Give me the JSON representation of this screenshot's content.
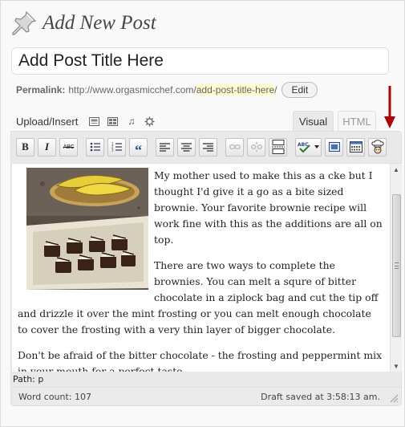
{
  "header": {
    "title": "Add New Post",
    "pin_icon": "pushpin-icon"
  },
  "title_input": {
    "value": "Add Post Title Here"
  },
  "permalink": {
    "label": "Permalink:",
    "base": "http://www.orgasmicchef.com/",
    "slug": "add-post-title-here",
    "trailing": "/",
    "edit_label": "Edit"
  },
  "upload": {
    "label": "Upload/Insert",
    "icons": [
      "add-image-icon",
      "add-video-icon",
      "add-audio-icon",
      "add-media-icon"
    ]
  },
  "tabs": {
    "visual": "Visual",
    "html": "HTML",
    "active": "Visual"
  },
  "toolbar": {
    "bold": "B",
    "italic": "I",
    "strikethrough": "ABC",
    "buttons": [
      "bold",
      "italic",
      "strikethrough",
      "bullet-list",
      "numbered-list",
      "blockquote",
      "align-left",
      "align-center",
      "align-right",
      "insert-link",
      "unlink",
      "insert-more",
      "spellcheck",
      "fullscreen",
      "kitchen-sink",
      "chef-plugin"
    ]
  },
  "content": {
    "paragraphs": [
      "My mother used to make this as a cke but I thought I'd give it a go as a bite sized brownie. Your favorite brownie recipe will work fine with this as the additions are all on top.",
      "There are two ways to complete the brownies. You can melt a squre of bitter chocolate in a ziplock bag and cut the tip off and drizzle it over the mint frosting or  you can melt enough chocolate to cover the frosting with a very thin layer of bigger chocolate.",
      "Don't be afraid of the bitter chocolate - the frosting and peppermint mix in your mouth for a perfect taste."
    ]
  },
  "path": {
    "text": "Path: p"
  },
  "status": {
    "word_count": "Word count: 107",
    "draft_saved": "Draft saved at 3:58:13 am."
  },
  "colors": {
    "accent_red": "#b30000",
    "slug_highlight": "#fffbcc"
  }
}
